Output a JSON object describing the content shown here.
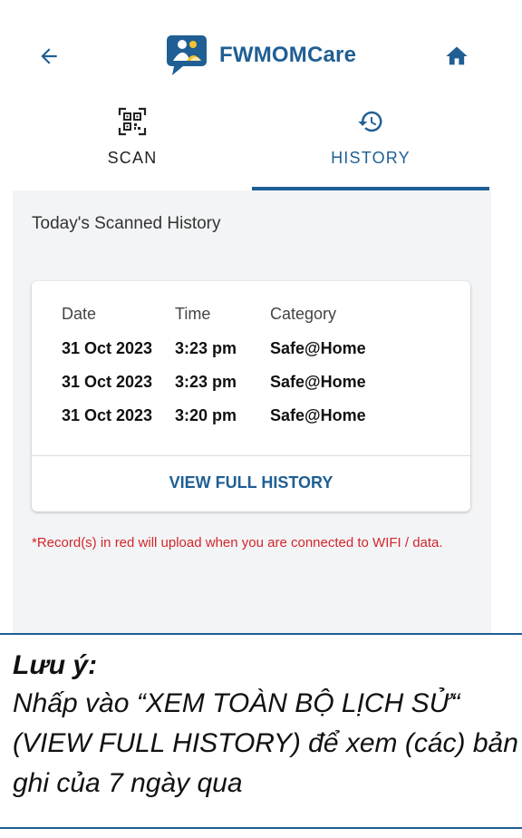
{
  "app": {
    "name": "FWMOMCare",
    "colors": {
      "brand": "#1f5f94",
      "warning": "#d3262b",
      "panel": "#f3f4f6"
    },
    "icons": {
      "back": "arrow-left-icon",
      "home": "home-icon",
      "logo": "fwmomcare-logo-icon"
    }
  },
  "tabs": [
    {
      "label": "SCAN",
      "icon": "qr-code-icon",
      "active": false
    },
    {
      "label": "HISTORY",
      "icon": "history-clock-icon",
      "active": true
    }
  ],
  "history": {
    "title": "Today's Scanned History",
    "columns": [
      "Date",
      "Time",
      "Category"
    ],
    "rows": [
      {
        "date": "31 Oct 2023",
        "time": "3:23 pm",
        "category": "Safe@Home"
      },
      {
        "date": "31 Oct 2023",
        "time": "3:23 pm",
        "category": "Safe@Home"
      },
      {
        "date": "31 Oct 2023",
        "time": "3:20 pm",
        "category": "Safe@Home"
      }
    ],
    "view_full_label": "VIEW FULL HISTORY",
    "upload_note": "*Record(s) in red will upload when you are connected to WIFI / data."
  },
  "caption": {
    "title": "Lưu ý:",
    "body": "Nhấp vào “XEM TOÀN BỘ LỊCH SỬ“ (VIEW FULL HISTORY) để xem (các) bản ghi của 7 ngày qua"
  }
}
